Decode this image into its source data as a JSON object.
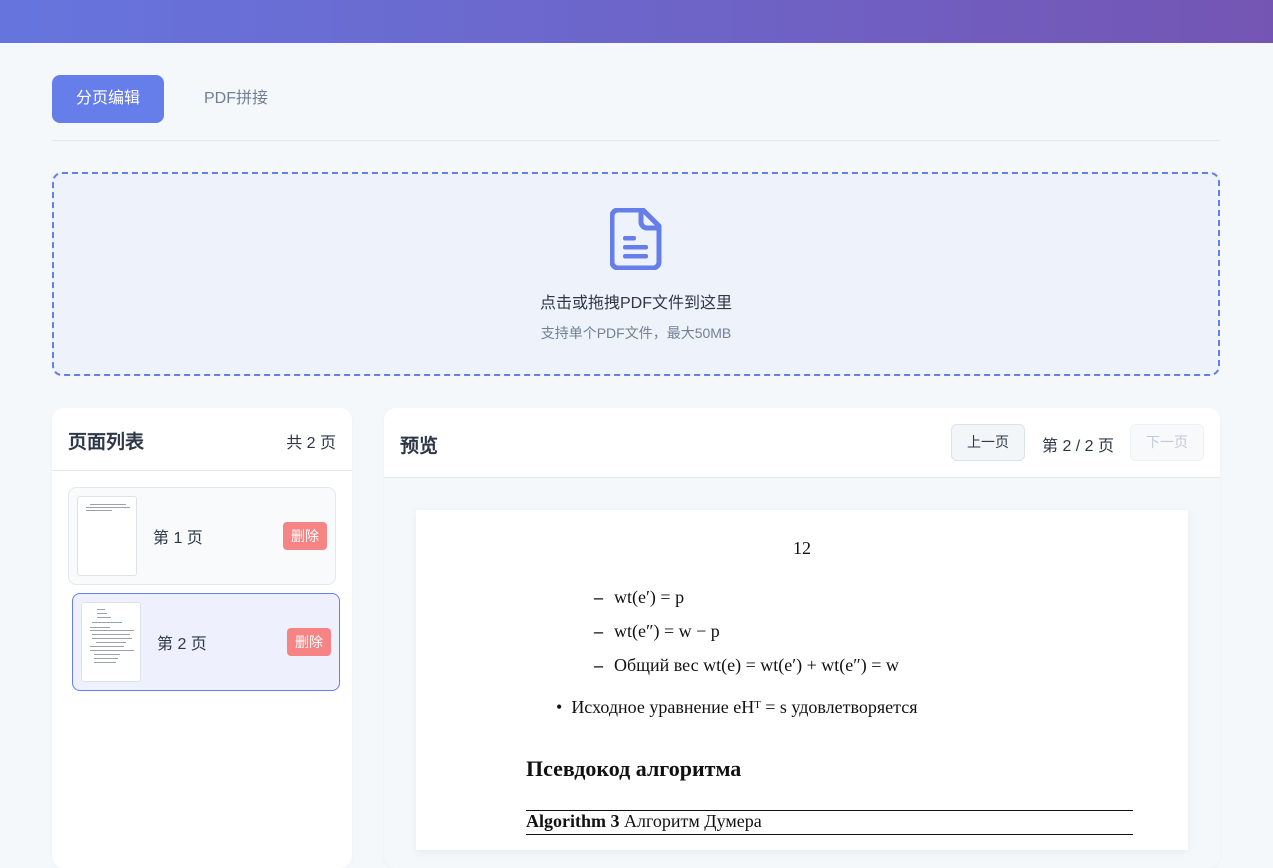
{
  "tabs": [
    {
      "label": "分页编辑",
      "active": true
    },
    {
      "label": "PDF拼接",
      "active": false
    }
  ],
  "upload": {
    "icon": "file-document-icon",
    "title": "点击或拖拽PDF文件到这里",
    "subtitle": "支持单个PDF文件，最大50MB"
  },
  "page_list": {
    "title": "页面列表",
    "count": "共 2 页",
    "items": [
      {
        "label": "第 1 页",
        "delete_label": "删除",
        "selected": false
      },
      {
        "label": "第 2 页",
        "delete_label": "删除",
        "selected": true
      }
    ]
  },
  "preview": {
    "title": "预览",
    "prev_label": "上一页",
    "next_label": "下一页",
    "page_indicator": "第 2 / 2 页",
    "page_content": {
      "page_number": "12",
      "lines": [
        "wt(e′) = p",
        "wt(e″) = w − p",
        "Общий вес wt(e) = wt(e′) + wt(e″) = w"
      ],
      "bullet": "Исходное уравнение eHᵀ = s удовлетворяется",
      "section_heading": "Псевдокод алгоритма",
      "algorithm_label": "Algorithm 3",
      "algorithm_title": "Алгоритм Думера"
    }
  },
  "colors": {
    "accent": "#667eea",
    "header_gradient_start": "#6675de",
    "header_gradient_end": "#7455b4",
    "delete": "#f68484"
  }
}
